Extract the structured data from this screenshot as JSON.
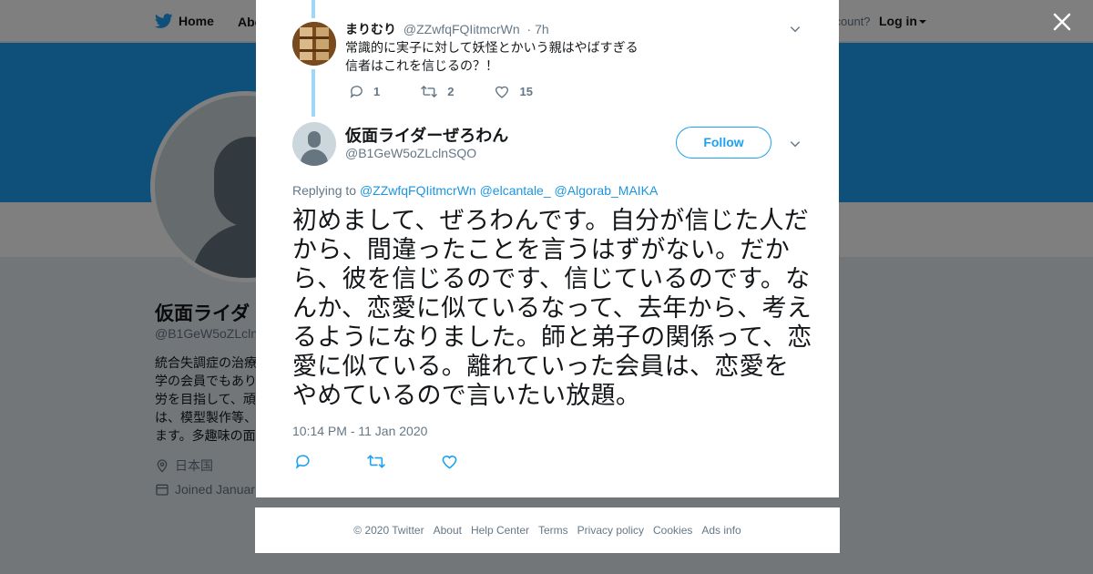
{
  "nav": {
    "home_label": "Home",
    "about_label": "Abo",
    "account_text": "ccount?",
    "login_label": "Log in"
  },
  "profile": {
    "name": "仮面ライダ",
    "handle": "@B1GeW5oZLcln",
    "bio": "統合失調症の治療学の会員でもあり労を目指して、頑は、模型製作等、ます。多趣味の面",
    "location": "日本国",
    "joined": "Joined Januar"
  },
  "reply_tweet": {
    "name": "まりむり",
    "handle": "@ZZwfqFQIitmcrWn",
    "time": "· 7h",
    "text_line1": "常識的に実子に対して妖怪とかいう親はやばすぎる",
    "text_line2": "信者はこれを信じるの？！",
    "reply_count": "1",
    "retweet_count": "2",
    "like_count": "15"
  },
  "main_tweet": {
    "name": "仮面ライダーぜろわん",
    "handle": "@B1GeW5oZLclnSQO",
    "follow_label": "Follow",
    "replying_prefix": "Replying to",
    "mentions": [
      "@ZZwfqFQIitmcrWn",
      "@elcantale_",
      "@Algorab_MAIKA"
    ],
    "text": "初めまして、ぜろわんです。自分が信じた人だから、間違ったことを言うはずがない。だから、彼を信じるのです、信じているのです。なんか、恋愛に似ているなって、去年から、考えるようになりました。師と弟子の関係って、恋愛に似ている。離れていった会員は、恋愛をやめているので言いたい放題。",
    "timestamp": "10:14 PM - 11 Jan 2020"
  },
  "footer": {
    "links": [
      "© 2020 Twitter",
      "About",
      "Help Center",
      "Terms",
      "Privacy policy",
      "Cookies",
      "Ads info"
    ]
  },
  "colors": {
    "accent": "#1da1f2",
    "link": "#1b95e0",
    "muted": "#657786",
    "thread_line": "#a0d7f7"
  },
  "icons": [
    "twitter-bird-icon",
    "close-icon",
    "reply-icon",
    "retweet-icon",
    "like-icon",
    "chevron-down-icon",
    "location-icon",
    "calendar-icon"
  ]
}
